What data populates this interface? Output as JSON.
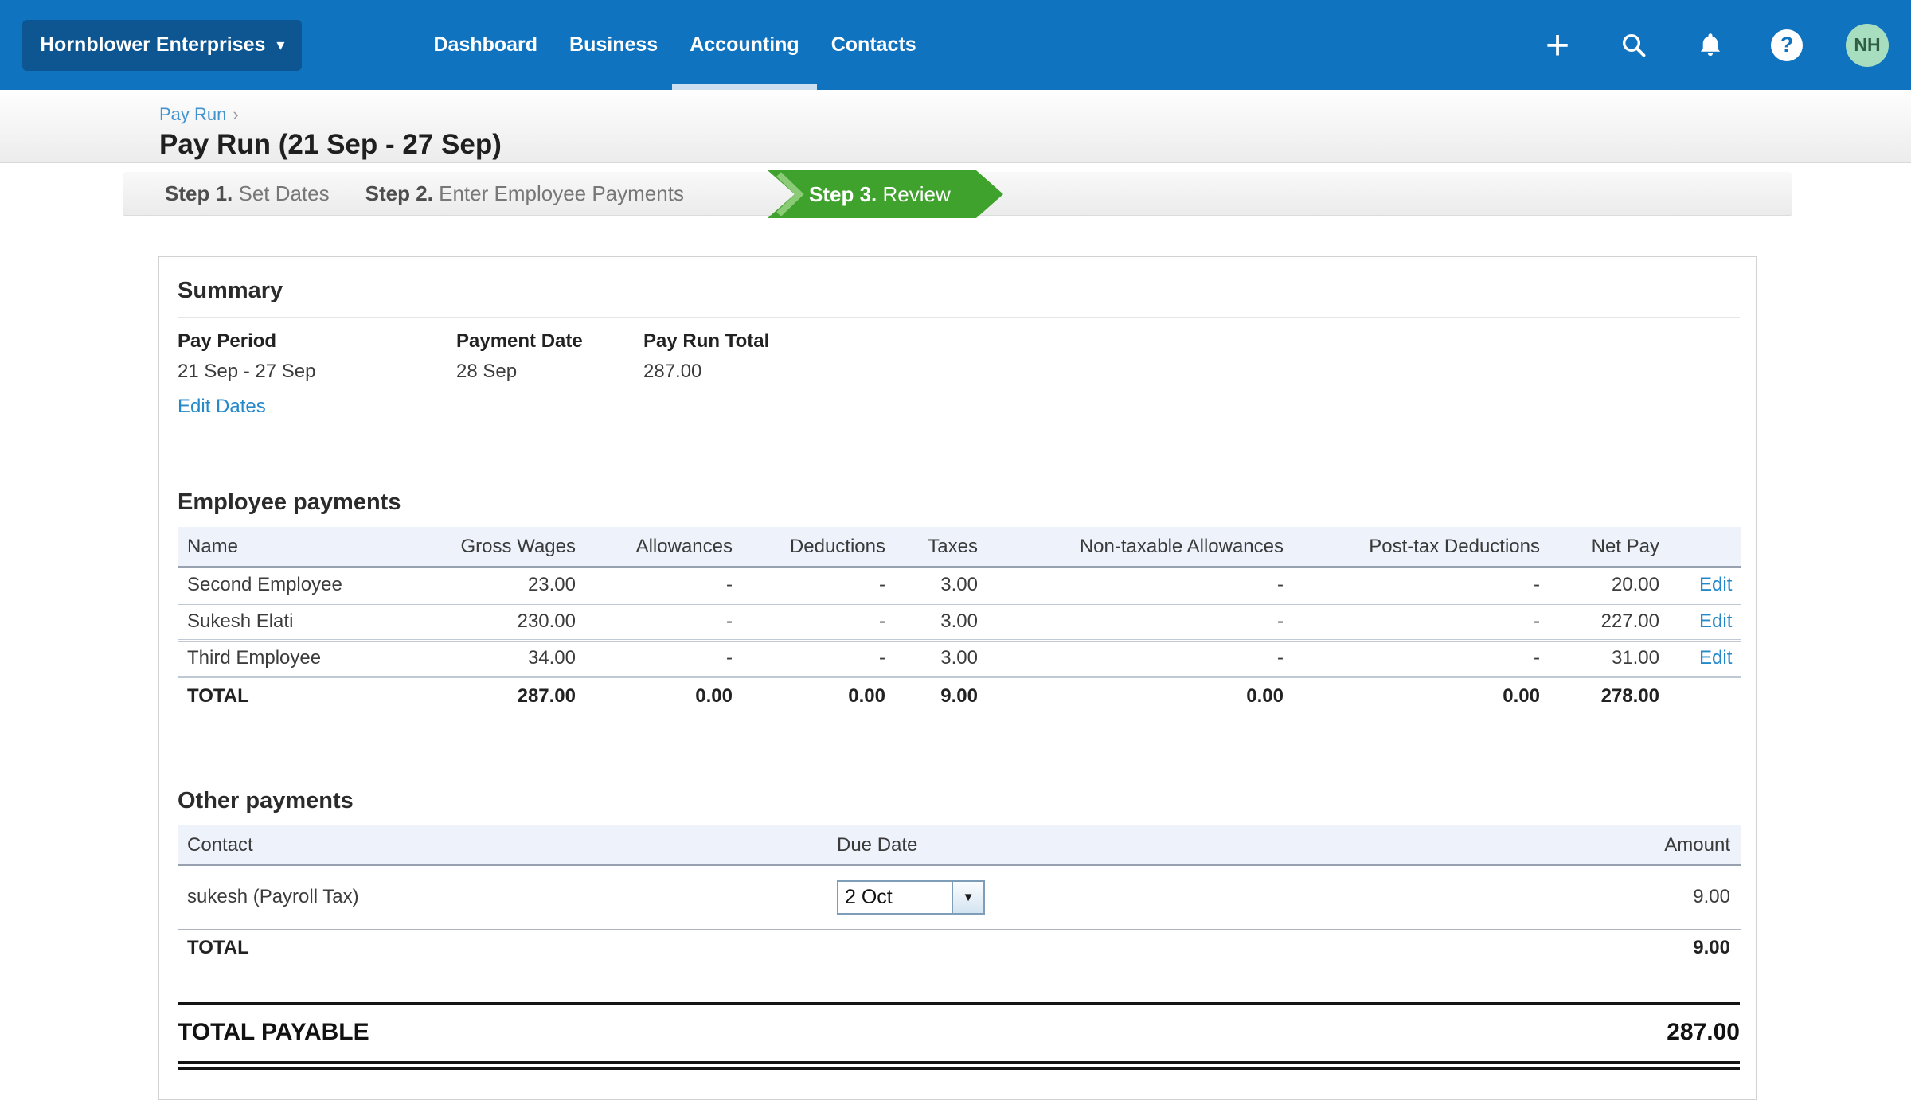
{
  "nav": {
    "org_label": "Hornblower Enterprises",
    "items": [
      "Dashboard",
      "Business",
      "Accounting",
      "Contacts"
    ],
    "active_item": "Accounting",
    "avatar": "NH",
    "help_glyph": "?",
    "plus_glyph": "+"
  },
  "breadcrumb": {
    "link": "Pay Run",
    "separator": "›"
  },
  "page": {
    "title": "Pay Run (21 Sep - 27 Sep)"
  },
  "steps": [
    {
      "prefix": "Step 1.",
      "label": " Set Dates",
      "state": "done"
    },
    {
      "prefix": "Step 2.",
      "label": " Enter Employee Payments",
      "state": "done"
    },
    {
      "prefix": "Step 3.",
      "label": " Review",
      "state": "current"
    }
  ],
  "summary": {
    "heading": "Summary",
    "fields": [
      {
        "label": "Pay Period",
        "value": "21 Sep - 27 Sep"
      },
      {
        "label": "Payment Date",
        "value": "28 Sep"
      },
      {
        "label": "Pay Run Total",
        "value": "287.00"
      }
    ],
    "edit_link": "Edit Dates"
  },
  "employee_payments": {
    "heading": "Employee payments",
    "columns": [
      "Name",
      "Gross Wages",
      "Allowances",
      "Deductions",
      "Taxes",
      "Non-taxable Allowances",
      "Post-tax Deductions",
      "Net Pay"
    ],
    "rows": [
      {
        "name": "Second Employee",
        "gross": "23.00",
        "allowances": "-",
        "deductions": "-",
        "taxes": "3.00",
        "nontax": "-",
        "posttax": "-",
        "net": "20.00",
        "action": "Edit"
      },
      {
        "name": "Sukesh Elati",
        "gross": "230.00",
        "allowances": "-",
        "deductions": "-",
        "taxes": "3.00",
        "nontax": "-",
        "posttax": "-",
        "net": "227.00",
        "action": "Edit"
      },
      {
        "name": "Third Employee",
        "gross": "34.00",
        "allowances": "-",
        "deductions": "-",
        "taxes": "3.00",
        "nontax": "-",
        "posttax": "-",
        "net": "31.00",
        "action": "Edit"
      }
    ],
    "total": {
      "label": "TOTAL",
      "gross": "287.00",
      "allowances": "0.00",
      "deductions": "0.00",
      "taxes": "9.00",
      "nontax": "0.00",
      "posttax": "0.00",
      "net": "278.00"
    }
  },
  "other_payments": {
    "heading": "Other payments",
    "columns": [
      "Contact",
      "Due Date",
      "Amount"
    ],
    "row": {
      "contact": "sukesh (Payroll Tax)",
      "due_date": "2 Oct",
      "amount": "9.00"
    },
    "total": {
      "label": "TOTAL",
      "amount": "9.00"
    }
  },
  "total_payable": {
    "label": "TOTAL PAYABLE",
    "amount": "287.00"
  },
  "colors": {
    "nav_blue": "#0F73C0",
    "org_button_blue": "#0D5691",
    "active_underline": "#CBDFF0",
    "step_green": "#3EA22C",
    "link_blue": "#2589C9",
    "table_header_band": "#EDF2FB",
    "avatar_bg": "#A7DEC0",
    "avatar_text": "#2F5C45"
  }
}
